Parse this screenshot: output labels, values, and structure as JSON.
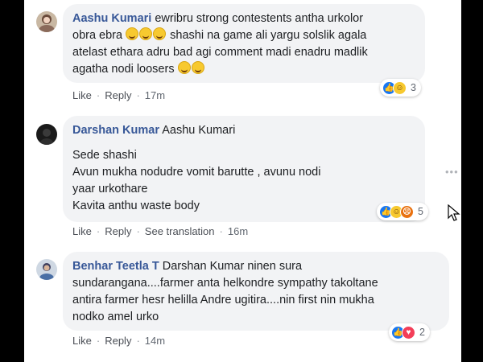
{
  "comments": [
    {
      "author": "Aashu Kumari",
      "lines": [
        "ewribru strong contestents antha urkolor",
        "obra ebra",
        "shashi na game ali yargu solslik agala",
        "atelast ethara adru bad agi comment madi enadru madlik",
        "agatha nodi loosers"
      ],
      "actions": {
        "like": "Like",
        "reply": "Reply",
        "time": "17m"
      },
      "reaction_count": "3",
      "reaction_types": [
        "like",
        "haha"
      ]
    },
    {
      "author": "Darshan Kumar",
      "mention": "Aashu Kumari",
      "lines": [
        "Sede shashi",
        "Avun mukha nodudre vomit barutte , avunu nodi",
        "yaar urkothare",
        "Kavita anthu waste body"
      ],
      "actions": {
        "like": "Like",
        "reply": "Reply",
        "translate": "See translation",
        "time": "16m"
      },
      "reaction_count": "5",
      "reaction_types": [
        "like",
        "haha",
        "angry"
      ]
    },
    {
      "author": "Benhar Teetla T",
      "mention": "Darshan Kumar",
      "lines": [
        "ninen sura",
        "sundarangana....farmer anta helkondre sympathy takoltane",
        "antira farmer hesr helilla Andre ugitira....nin first nin mukha",
        "nodko amel urko"
      ],
      "actions": {
        "like": "Like",
        "reply": "Reply",
        "time": "14m"
      },
      "reaction_count": "2",
      "reaction_types": [
        "like",
        "love"
      ]
    }
  ],
  "more_label": "•••",
  "colors": {
    "link": "#385898",
    "bubble": "#f2f3f5",
    "like": "#1877f2"
  }
}
